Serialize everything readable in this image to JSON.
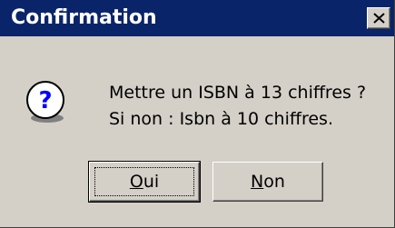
{
  "window": {
    "title": "Confirmation"
  },
  "message": {
    "line1": "Mettre un ISBN à 13 chiffres ?",
    "line2": "Si non : Isbn à 10 chiffres."
  },
  "buttons": {
    "yes_mnemonic": "O",
    "yes_rest": "ui",
    "no_mnemonic": "N",
    "no_rest": "on"
  },
  "icons": {
    "close": "close-icon",
    "question": "question-icon"
  },
  "colors": {
    "titlebar": "#0a246a",
    "face": "#d4d0c8",
    "icon_fill": "#ffffff",
    "icon_glyph": "#0000ff"
  }
}
